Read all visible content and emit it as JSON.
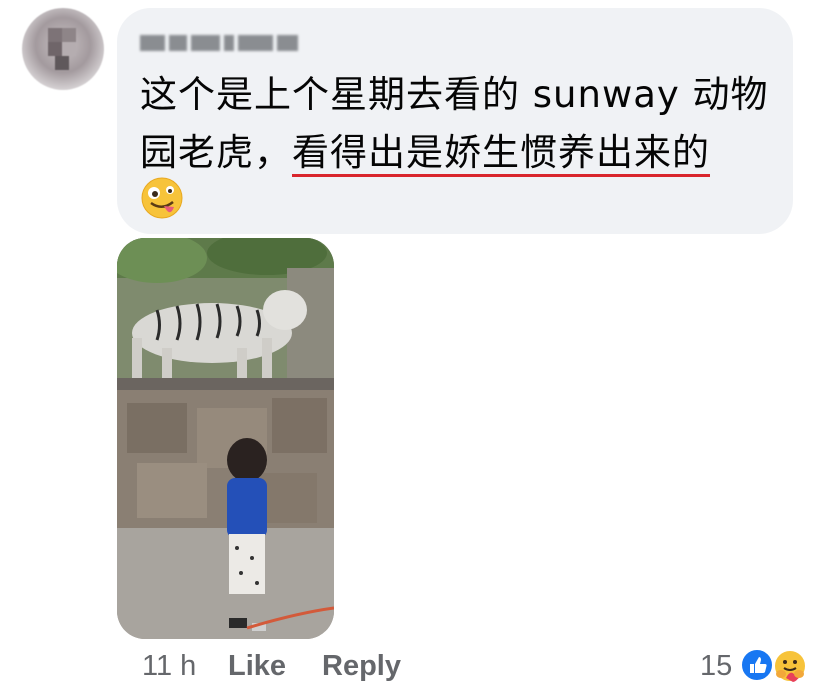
{
  "comment": {
    "author": "",
    "text_line1": "这个是上个星期去看的 sunway 动物",
    "text_line2_plain": "园老虎，",
    "text_line2_highlight": "看得出是娇生惯养出来的",
    "emoji": "zany-face-emoji"
  },
  "footer": {
    "time": "11 h",
    "like_label": "Like",
    "reply_label": "Reply",
    "reaction_count": "15",
    "reactions": [
      "like-reaction-icon",
      "care-reaction-icon"
    ]
  },
  "colors": {
    "bubble": "#f0f2f5",
    "highlight_underline": "#d9252c",
    "meta_text": "#65676b",
    "like_blue": "#1877f2"
  }
}
